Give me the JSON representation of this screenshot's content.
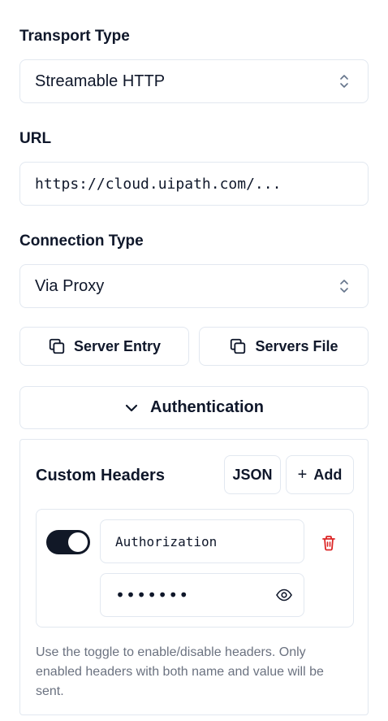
{
  "transport": {
    "label": "Transport Type",
    "value": "Streamable HTTP"
  },
  "url": {
    "label": "URL",
    "value": "https://cloud.uipath.com/..."
  },
  "connection": {
    "label": "Connection Type",
    "value": "Via Proxy"
  },
  "actions": {
    "server_entry": "Server Entry",
    "servers_file": "Servers File"
  },
  "auth": {
    "label": "Authentication"
  },
  "custom_headers": {
    "title": "Custom Headers",
    "json_label": "JSON",
    "add_label": "Add",
    "add_symbol": "+",
    "header": {
      "enabled": true,
      "name": "Authorization",
      "value_masked": "•••••••"
    },
    "note": "Use the toggle to enable/disable headers. Only enabled headers with both name and value will be sent."
  }
}
